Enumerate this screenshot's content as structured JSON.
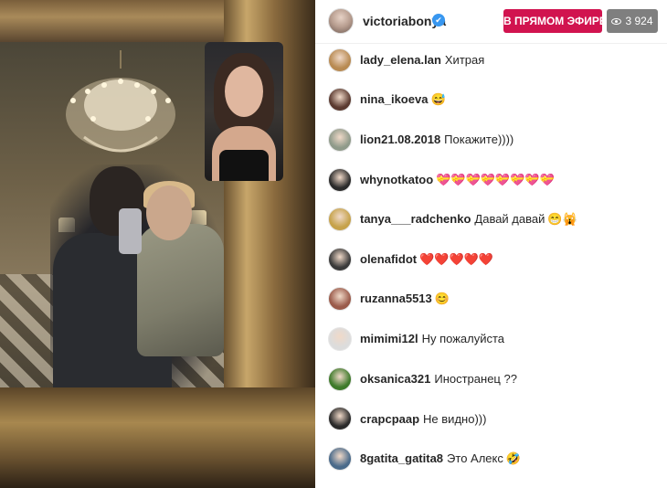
{
  "header": {
    "username": "victoriabonya",
    "verified_glyph": "✔",
    "live_label": "В ПРЯМОМ ЭФИРЕ",
    "viewer_count": "3 924"
  },
  "comments": [
    {
      "user": "lady_elena.lan",
      "text": "Хитрая",
      "emoji": "",
      "avatar_color": "#b88a52"
    },
    {
      "user": "nina_ikoeva",
      "text": "",
      "emoji": "😅",
      "avatar_color": "#5b3a30"
    },
    {
      "user": "lion21.08.2018",
      "text": "Покажите))))",
      "emoji": "",
      "avatar_color": "#8f9a8a"
    },
    {
      "user": "whynotkatoo",
      "text": "",
      "emoji": "💝💝💝💝💝💝💝💝",
      "avatar_color": "#2b2b2b"
    },
    {
      "user": "tanya___radchenko",
      "text": "Давай давай",
      "emoji": "😁🙀",
      "avatar_color": "#c6a24a"
    },
    {
      "user": "olenafidot",
      "text": "",
      "emoji": "❤️❤️❤️❤️❤️",
      "avatar_color": "#3a3a3a"
    },
    {
      "user": "ruzanna5513",
      "text": "",
      "emoji": "😊",
      "avatar_color": "#9a5a4a"
    },
    {
      "user": "mimimi12l",
      "text": "Ну пожалуйста",
      "emoji": "",
      "avatar_color": "#dcdcdc"
    },
    {
      "user": "oksanica321",
      "text": "Иностранец ??",
      "emoji": "",
      "avatar_color": "#3e7a2a"
    },
    {
      "user": "crapcpaap",
      "text": "Не видно)))",
      "emoji": "",
      "avatar_color": "#2a2a2a"
    },
    {
      "user": "8gatita_gatita8",
      "text": "Это Алекс",
      "emoji": "🤣",
      "avatar_color": "#4a6a8a"
    }
  ]
}
